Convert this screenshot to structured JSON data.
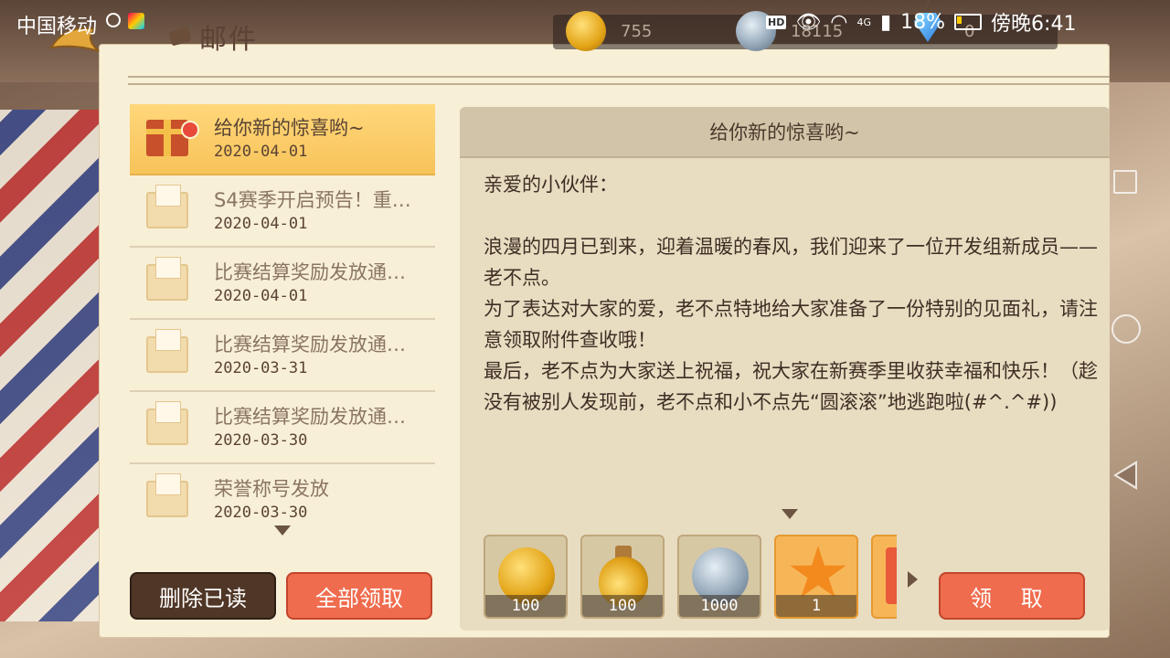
{
  "statusbar": {
    "carrier": "中国移动",
    "hd": "HD",
    "network": "4G",
    "battery": "18%",
    "time": "傍晚6:41"
  },
  "header": {
    "title": "邮件"
  },
  "currency": {
    "gold": "755",
    "silver": "18115",
    "diamond": "0"
  },
  "mail_list": [
    {
      "title": "给你新的惊喜哟~",
      "date": "2020-04-01",
      "icon": "gift-icon",
      "selected": true,
      "unread": true
    },
    {
      "title": "S4赛季开启预告！重…",
      "date": "2020-04-01",
      "icon": "envelope-icon"
    },
    {
      "title": "比赛结算奖励发放通…",
      "date": "2020-04-01",
      "icon": "envelope-icon"
    },
    {
      "title": "比赛结算奖励发放通…",
      "date": "2020-03-31",
      "icon": "envelope-icon"
    },
    {
      "title": "比赛结算奖励发放通…",
      "date": "2020-03-30",
      "icon": "envelope-icon"
    },
    {
      "title": "荣誉称号发放",
      "date": "2020-03-30",
      "icon": "envelope-icon"
    }
  ],
  "buttons": {
    "delete_read": "删除已读",
    "claim_all": "全部领取",
    "claim": "领 取"
  },
  "detail": {
    "subject": "给你新的惊喜哟~",
    "lines": [
      "亲爱的小伙伴：",
      "",
      "浪漫的四月已到来，迎着温暖的春风，我们迎来了一位开发组新成员——老不点。",
      "为了表达对大家的爱，老不点特地给大家准备了一份特别的见面礼，请注意领取附件查收哦！",
      "最后，老不点为大家送上祝福，祝大家在新赛季里收获幸福和快乐！（趁没有被别人发现前，老不点和小不点先“圆滚滚”地逃跑啦(#^.^#))"
    ]
  },
  "attachments": [
    {
      "icon": "gold-coin-icon",
      "count": "100"
    },
    {
      "icon": "potion-icon",
      "count": "100"
    },
    {
      "icon": "silver-coin-icon",
      "count": "1000"
    },
    {
      "icon": "star-icon",
      "count": "1"
    },
    {
      "icon": "card-icon",
      "count": ""
    }
  ],
  "colors": {
    "accent": "#ef6c4e",
    "dark_button": "#4f3626",
    "selected_item": "#f7c35a",
    "parchment": "#f8efd7"
  }
}
